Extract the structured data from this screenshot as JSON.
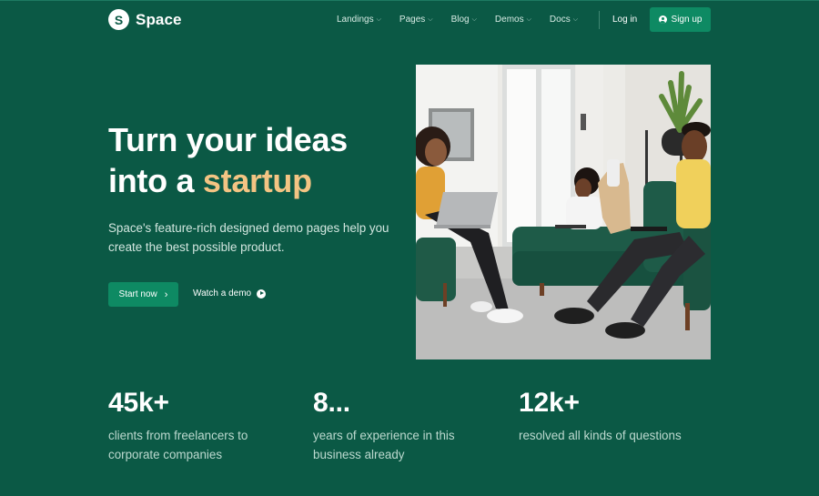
{
  "brand": {
    "logo_letter": "S",
    "name": "Space"
  },
  "nav": {
    "menu": [
      {
        "label": "Landings"
      },
      {
        "label": "Pages"
      },
      {
        "label": "Blog"
      },
      {
        "label": "Demos"
      },
      {
        "label": "Docs"
      }
    ],
    "login_label": "Log in",
    "signup_label": "Sign up"
  },
  "hero": {
    "headline_line1": "Turn your ideas",
    "headline_line2_prefix": "into a ",
    "headline_accent": "startup",
    "subtext": "Space's feature-rich designed demo pages help you create the best possible product.",
    "primary_button": "Start now",
    "secondary_button": "Watch a demo"
  },
  "stats": [
    {
      "value": "45k+",
      "description": "clients from freelancers to corporate companies"
    },
    {
      "value": "8...",
      "description": "years of experience in this business already"
    },
    {
      "value": "12k+",
      "description": "resolved all kinds of questions"
    }
  ],
  "colors": {
    "background": "#0b5945",
    "accent_green": "#0e8a63",
    "highlight": "#f3c483"
  }
}
